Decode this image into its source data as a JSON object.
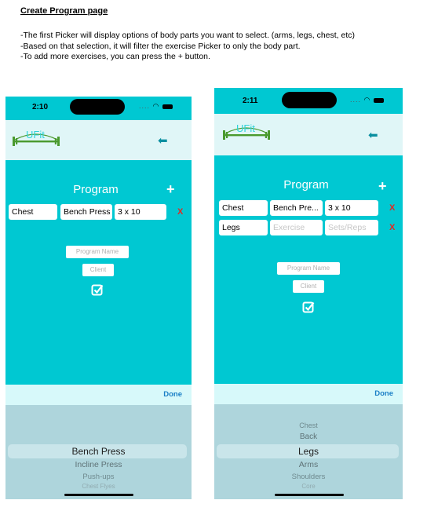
{
  "doc": {
    "title": "Create Program page",
    "lines": [
      "-The first Picker will display options of body parts you want to select. (arms, legs, chest, etc)",
      "-Based on that selection, it will filter the exercise Picker to only the body part.",
      "-To add more exercises, you can press the + button."
    ]
  },
  "colors": {
    "brand": "#00c8d2",
    "navbar": "#e0f6f7",
    "delete": "#e4281f",
    "done": "#1a7fc6",
    "picker": "#aed5dc"
  },
  "left_phone": {
    "time": "2:10",
    "logo_text": "UFit",
    "title": "Program",
    "add_label": "+",
    "row1": {
      "body_part": "Chest",
      "exercise": "Bench Press",
      "sets": "3 x 10",
      "delete": "X"
    },
    "program_name_placeholder": "Program Name",
    "client_placeholder": "Client",
    "done_label": "Done",
    "picker": {
      "selected": "Bench Press",
      "options_below": [
        "Incline Press",
        "Push-ups",
        "Chest Flyes"
      ]
    }
  },
  "right_phone": {
    "time": "2:11",
    "logo_text": "UFit",
    "title": "Program",
    "add_label": "+",
    "row1": {
      "body_part": "Chest",
      "exercise": "Bench Pre...",
      "sets": "3 x 10",
      "delete": "X"
    },
    "row2": {
      "body_part": "Legs",
      "exercise_placeholder": "Exercise",
      "sets_placeholder": "Sets/Reps",
      "delete": "X"
    },
    "program_name_placeholder": "Program Name",
    "client_placeholder": "Client",
    "done_label": "Done",
    "picker": {
      "options_above": [
        "Chest",
        "Back"
      ],
      "selected": "Legs",
      "options_below": [
        "Arms",
        "Shoulders",
        "Core"
      ]
    }
  }
}
